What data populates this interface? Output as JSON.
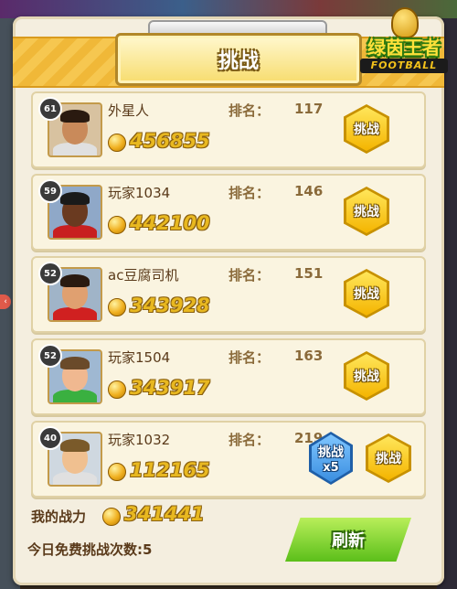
{
  "header": {
    "title": "挑战",
    "logo_text": "绿茵王者",
    "logo_subtext": "FOOTBALL"
  },
  "rank_label": "排名：",
  "challenge_label": "挑战",
  "players": [
    {
      "name": "外星人",
      "level": "61",
      "rank": "117",
      "power": "456855",
      "hair": "#2a1a10",
      "skin": "#c98a5a",
      "shirt": "#e0e0e0",
      "bg": "#d8c2a0"
    },
    {
      "name": "玩家1034",
      "level": "59",
      "rank": "146",
      "power": "442100",
      "hair": "#1a1a1a",
      "skin": "#6a3a20",
      "shirt": "#c82020",
      "bg": "#8fa8c8"
    },
    {
      "name": "ac豆腐司机",
      "level": "52",
      "rank": "151",
      "power": "343928",
      "hair": "#2a1a10",
      "skin": "#e0a070",
      "shirt": "#d02020",
      "bg": "#a0b4c8"
    },
    {
      "name": "玩家1504",
      "level": "52",
      "rank": "163",
      "power": "343917",
      "hair": "#6a4a2a",
      "skin": "#f0b890",
      "shirt": "#3ab040",
      "bg": "#9fb8d2"
    },
    {
      "name": "玩家1032",
      "level": "40",
      "rank": "219",
      "power": "112165",
      "hair": "#7a5a2a",
      "skin": "#f0c090",
      "shirt": "#e0e0e0",
      "bg": "#cfd8e0"
    }
  ],
  "multi_challenge": {
    "label": "挑战",
    "multiplier": "x5"
  },
  "footer": {
    "my_power_label": "我的战力",
    "my_power": "341441",
    "free_attempts": "今日免费挑战次数:5",
    "refresh_label": "刷新"
  },
  "colors": {
    "accent_yellow": "#f4b400",
    "accent_green": "#5bbf1a",
    "accent_blue": "#3b8ee0",
    "panel_bg": "#f4eedf"
  }
}
